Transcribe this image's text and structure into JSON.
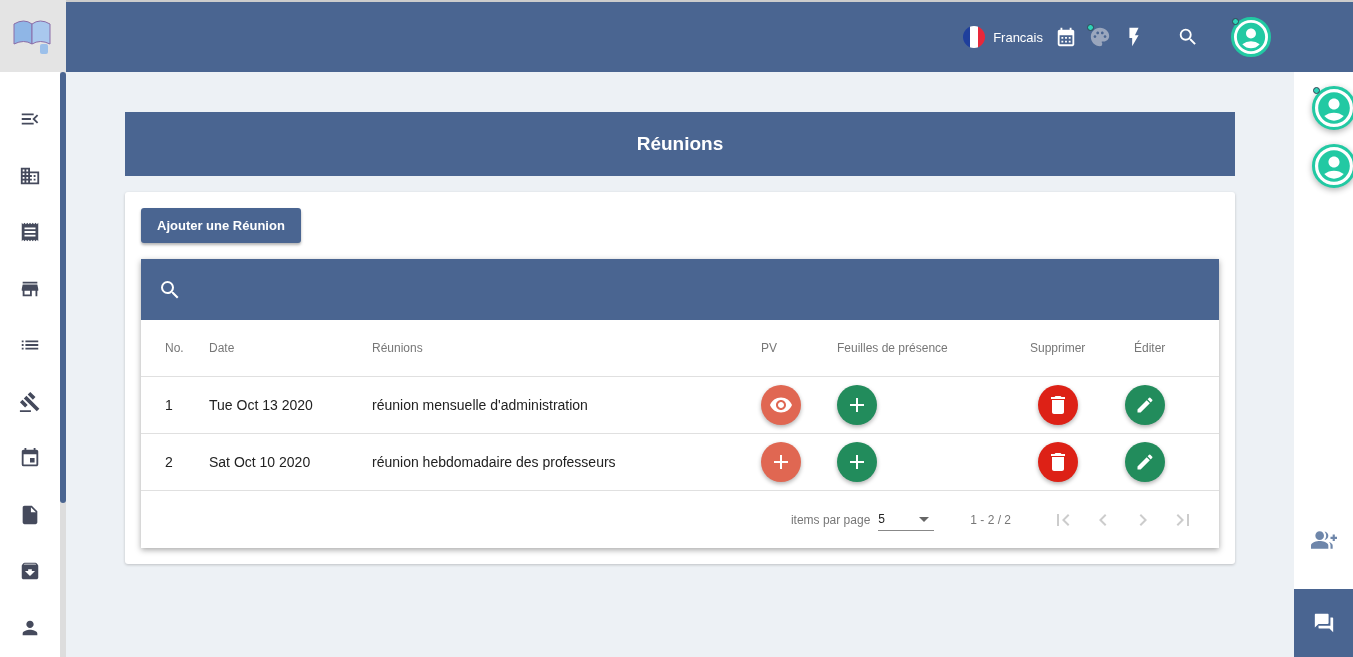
{
  "topbar": {
    "language": "Francais"
  },
  "page": {
    "title": "Réunions",
    "add_button": "Ajouter une Réunion"
  },
  "table": {
    "columns": [
      "No.",
      "Date",
      "Réunions",
      "PV",
      "Feuilles de présence",
      "Supprimer",
      "Éditer"
    ],
    "rows": [
      {
        "no": "1",
        "date": "Tue Oct 13 2020",
        "title": "réunion mensuelle d'administration",
        "pv_button": {
          "kind": "view"
        }
      },
      {
        "no": "2",
        "date": "Sat Oct 10 2020",
        "title": "réunion hebdomadaire des professeurs",
        "pv_button": {
          "kind": "add"
        }
      }
    ],
    "pagination": {
      "label": "items par page",
      "page_size": "5",
      "range": "1 - 2 / 2"
    }
  }
}
